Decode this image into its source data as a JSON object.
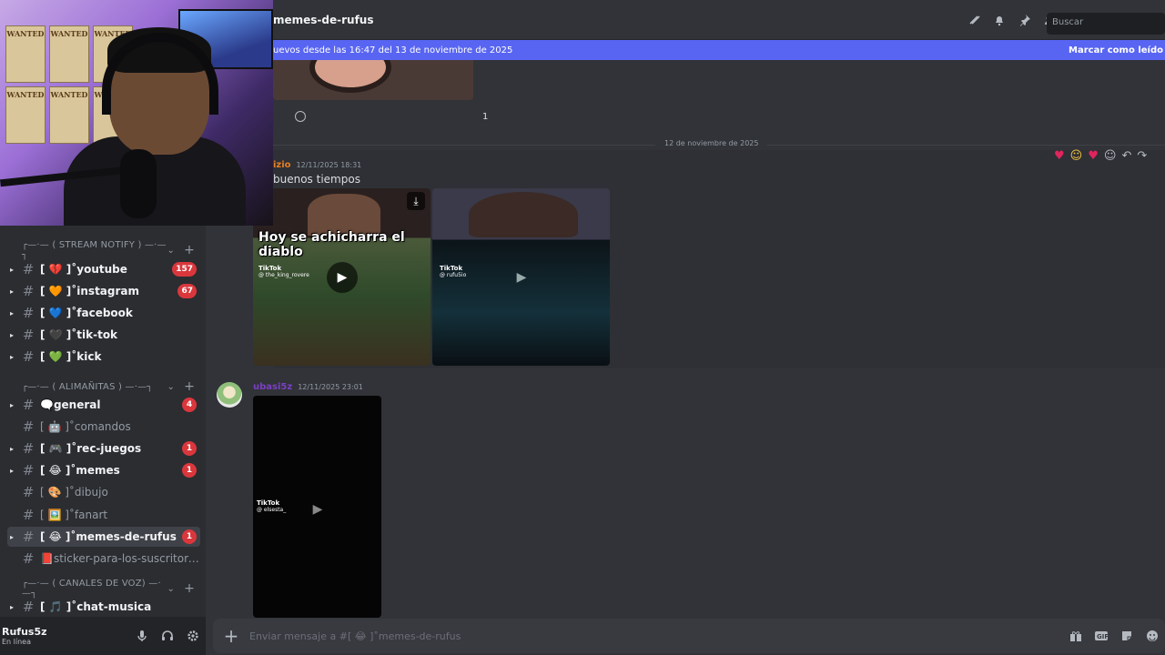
{
  "webcam": {
    "posters": [
      "WANTED",
      "WANTED",
      "WANTED",
      "WANTED",
      "WANTED",
      "WANTED"
    ]
  },
  "sidebar": {
    "categories": [
      {
        "label": "┌—·— ( STREAM NOTIFY ) —·—┐",
        "chevron": "⌄",
        "plus": "+"
      },
      {
        "label": "┌—·— ( ALIMAÑITAS ) —·—┐",
        "chevron": "⌄",
        "plus": "+"
      },
      {
        "label": "┌—·— ( CANALES DE VOZ) —·—┐",
        "chevron": "⌄",
        "plus": "+"
      }
    ],
    "channels": [
      {
        "name": "[ 💔 ]˚youtube",
        "badge": "157"
      },
      {
        "name": "[ 🧡 ]˚instagram",
        "badge": "67"
      },
      {
        "name": "[ 💙 ]˚facebook",
        "badge": ""
      },
      {
        "name": "[ 🖤 ]˚tik-tok",
        "badge": ""
      },
      {
        "name": "[ 💚 ]˚kick",
        "badge": ""
      },
      {
        "name": "🗨️general",
        "badge": "4"
      },
      {
        "name": "[ 🤖 ]˚comandos",
        "badge": ""
      },
      {
        "name": "[ 🎮 ]˚rec-juegos",
        "badge": "1"
      },
      {
        "name": "[ 😂 ]˚memes",
        "badge": "1"
      },
      {
        "name": "[ 🎨 ]˚dibujo",
        "badge": ""
      },
      {
        "name": "[ 🖼️ ]˚fanart",
        "badge": ""
      },
      {
        "name": "[ 😂 ]˚memes-de-rufus",
        "badge": "1"
      },
      {
        "name": "📕sticker-para-los-suscritores-...",
        "badge": ""
      },
      {
        "name": "[ 🎵 ]˚chat-musica",
        "badge": ""
      }
    ]
  },
  "user": {
    "name": "Rufus5z",
    "status": "En línea"
  },
  "header": {
    "channel": "memes-de-rufus",
    "search_placeholder": "Buscar"
  },
  "new_bar": {
    "text": "uevos desde las 16:47 del 13 de noviembre de 2025",
    "action": "Marcar como leído"
  },
  "reaction": {
    "count": "1"
  },
  "date_divider": "12 de noviembre de 2025",
  "messages": [
    {
      "author": "izio",
      "timestamp": "12/11/2025 18:31",
      "text": "buenos tiempos",
      "author_color": "#e67e22"
    },
    {
      "author": "ubasi5z",
      "timestamp": "12/11/2025 23:01",
      "text": "",
      "author_color": "#7b3fc4"
    }
  ],
  "video": {
    "caption": "Hoy se achicharra el diablo",
    "brand": "TikTok",
    "handle1": "@ the_king_rovere",
    "handle2": "@ rufu5io",
    "handle3": "@ elsesta_"
  },
  "composer": {
    "placeholder": "Enviar mensaje a #[ 😂 ]˚memes-de-rufus"
  },
  "icons": {
    "hash": "#",
    "arrow": "▸",
    "plus": "+",
    "play": "▶",
    "download": "⤓"
  }
}
